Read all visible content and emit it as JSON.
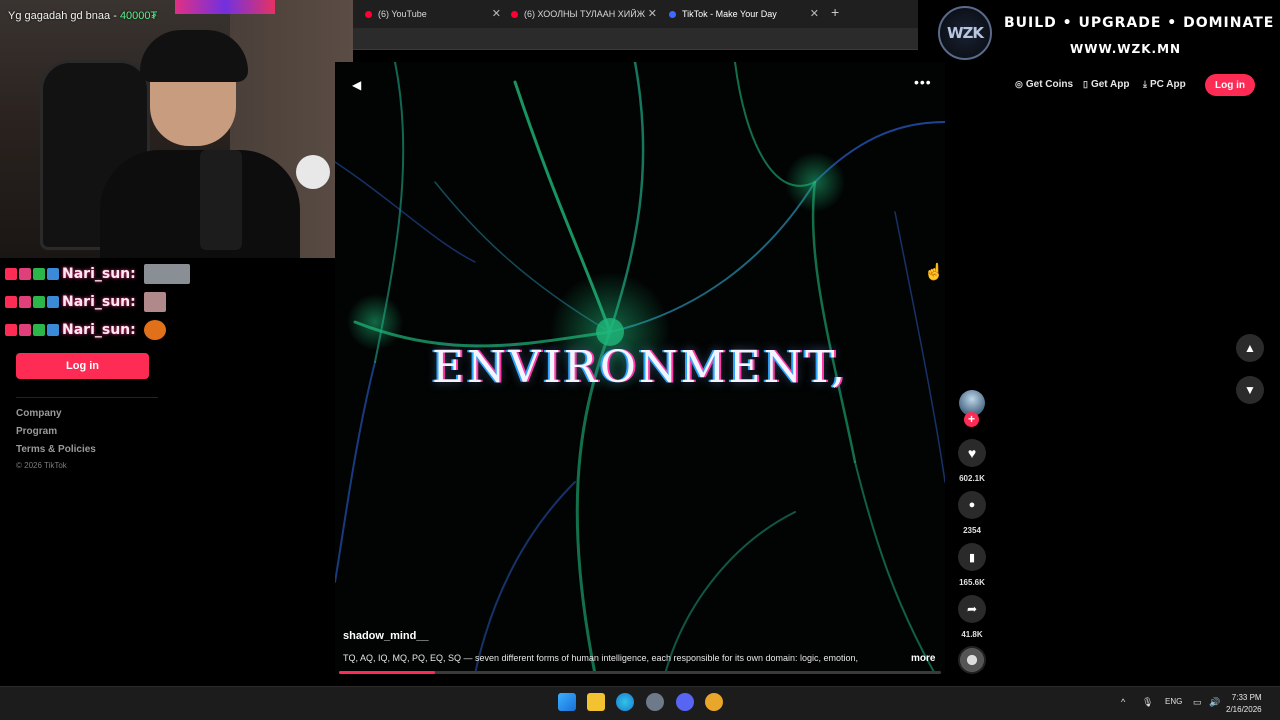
{
  "browser": {
    "tabs": [
      {
        "label": "(6) YouTube",
        "favicon_color": "#ff0033"
      },
      {
        "label": "(6) ХООЛНЫ ТУЛААН ХИЙЖ ОРО",
        "favicon_color": "#ff0033"
      },
      {
        "label": "TikTok - Make Your Day",
        "favicon_color": "#3d6bff",
        "active": true
      }
    ],
    "new_tab": "+"
  },
  "stream": {
    "ticker": {
      "text": "Yg gagadah gd bnaa - ",
      "amount": "40000₮"
    },
    "chat": [
      {
        "user": "Nari_sun:",
        "emote_color": "#8a8f96"
      },
      {
        "user": "Nari_sun:",
        "emote_color": "#b08a8a"
      },
      {
        "user": "Nari_sun:",
        "emote_color": "#e0701a"
      }
    ]
  },
  "sidebar": {
    "login_label": "Log in",
    "links": [
      "Company",
      "Program",
      "Terms & Policies"
    ],
    "copyright": "© 2026 TikTok"
  },
  "header": {
    "get_coins": "Get Coins",
    "get_app": "Get App",
    "pc_app": "PC App",
    "login": "Log in"
  },
  "sponsor": {
    "logo": "WZK",
    "tagline": "BUILD • UPGRADE • DOMINATE",
    "url": "WWW.WZK.MN"
  },
  "video": {
    "overlay_title": "ENVIRONMENT,",
    "author": "shadow_mind__",
    "caption": "TQ, AQ, IQ, MQ, PQ, EQ, SQ — seven different forms of human intelligence, each responsible for its own domain: logic, emotion,",
    "more": "more",
    "progress": 0.16
  },
  "actions": {
    "likes": "602.1K",
    "comments": "2354",
    "saves": "165.6K",
    "shares": "41.8K"
  },
  "taskbar": {
    "lang": "ENG",
    "time": "7:33 PM",
    "date": "2/16/2026"
  },
  "colors": {
    "tiktok_red": "#fe2c55",
    "neuron_green": "#1fb87a",
    "neuron_blue": "#2a5fd0"
  }
}
